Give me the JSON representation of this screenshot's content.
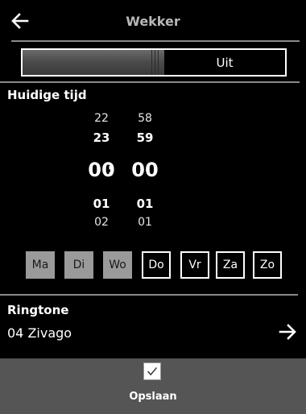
{
  "header": {
    "title": "Wekker",
    "back_icon": "arrow-left-icon"
  },
  "alarm_toggle": {
    "state_label": "Uit",
    "is_on": false
  },
  "time": {
    "label": "Huidige tijd",
    "hours": {
      "prev2": "22",
      "prev1": "23",
      "current": "00",
      "next1": "01",
      "next2": "02"
    },
    "minutes": {
      "prev2": "58",
      "prev1": "59",
      "current": "00",
      "next1": "01",
      "next2": "01"
    },
    "separator": ":"
  },
  "days": [
    {
      "label": "Ma",
      "selected": true
    },
    {
      "label": "Di",
      "selected": true
    },
    {
      "label": "Wo",
      "selected": true
    },
    {
      "label": "Do",
      "selected": false
    },
    {
      "label": "Vr",
      "selected": false
    },
    {
      "label": "Za",
      "selected": false
    },
    {
      "label": "Zo",
      "selected": false
    }
  ],
  "ringtone": {
    "label": "Ringtone",
    "value": "04 Zivago",
    "arrow_icon": "arrow-right-icon"
  },
  "footer": {
    "save_label": "Opslaan",
    "checkbox_icon": "checkbox-checked-icon"
  },
  "colors": {
    "background": "#000000",
    "footer": "#555555",
    "selected_day": "#9a9a9a",
    "title": "#b8b8b8"
  }
}
